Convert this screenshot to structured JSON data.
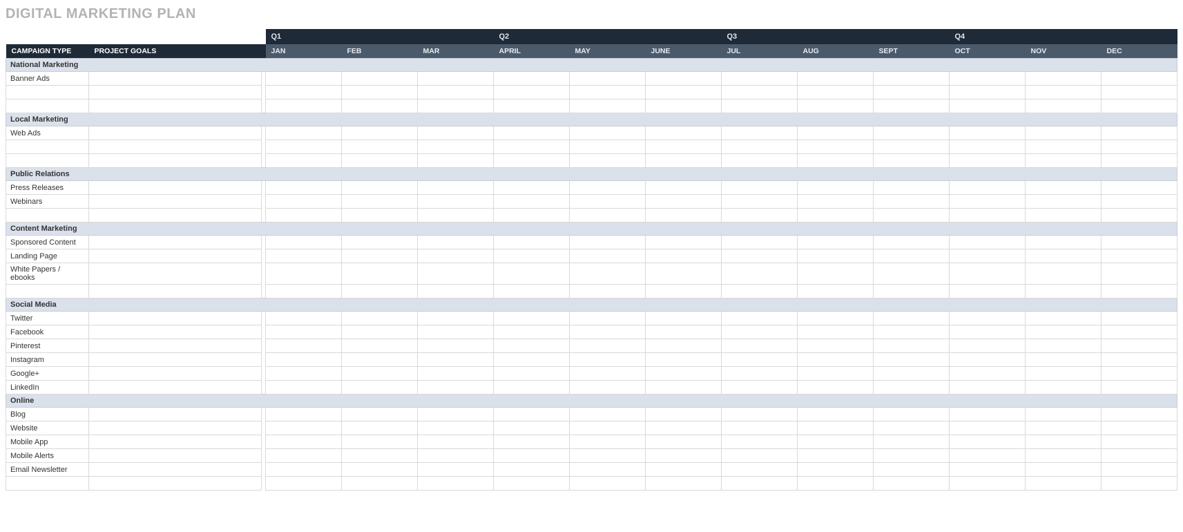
{
  "title": "DIGITAL MARKETING PLAN",
  "columns": {
    "c0": "CAMPAIGN TYPE",
    "c1": "PROJECT GOALS"
  },
  "quarters": {
    "q1": "Q1",
    "q2": "Q2",
    "q3": "Q3",
    "q4": "Q4"
  },
  "months": {
    "m1": "JAN",
    "m2": "FEB",
    "m3": "MAR",
    "m4": "APRIL",
    "m5": "MAY",
    "m6": "JUNE",
    "m7": "JUL",
    "m8": "AUG",
    "m9": "SEPT",
    "m10": "OCT",
    "m11": "NOV",
    "m12": "DEC"
  },
  "sections": [
    {
      "name": "National Marketing",
      "rows": [
        "Banner Ads",
        "",
        ""
      ]
    },
    {
      "name": "Local Marketing",
      "rows": [
        "Web Ads",
        "",
        ""
      ]
    },
    {
      "name": "Public Relations",
      "rows": [
        "Press Releases",
        "Webinars",
        ""
      ]
    },
    {
      "name": "Content Marketing",
      "rows": [
        "Sponsored Content",
        "Landing Page",
        "White Papers / ebooks",
        ""
      ]
    },
    {
      "name": "Social Media",
      "rows": [
        "Twitter",
        "Facebook",
        "Pinterest",
        "Instagram",
        "Google+",
        "LinkedIn"
      ]
    },
    {
      "name": "Online",
      "rows": [
        "Blog",
        "Website",
        "Mobile App",
        "Mobile Alerts",
        "Email Newsletter",
        ""
      ]
    }
  ]
}
